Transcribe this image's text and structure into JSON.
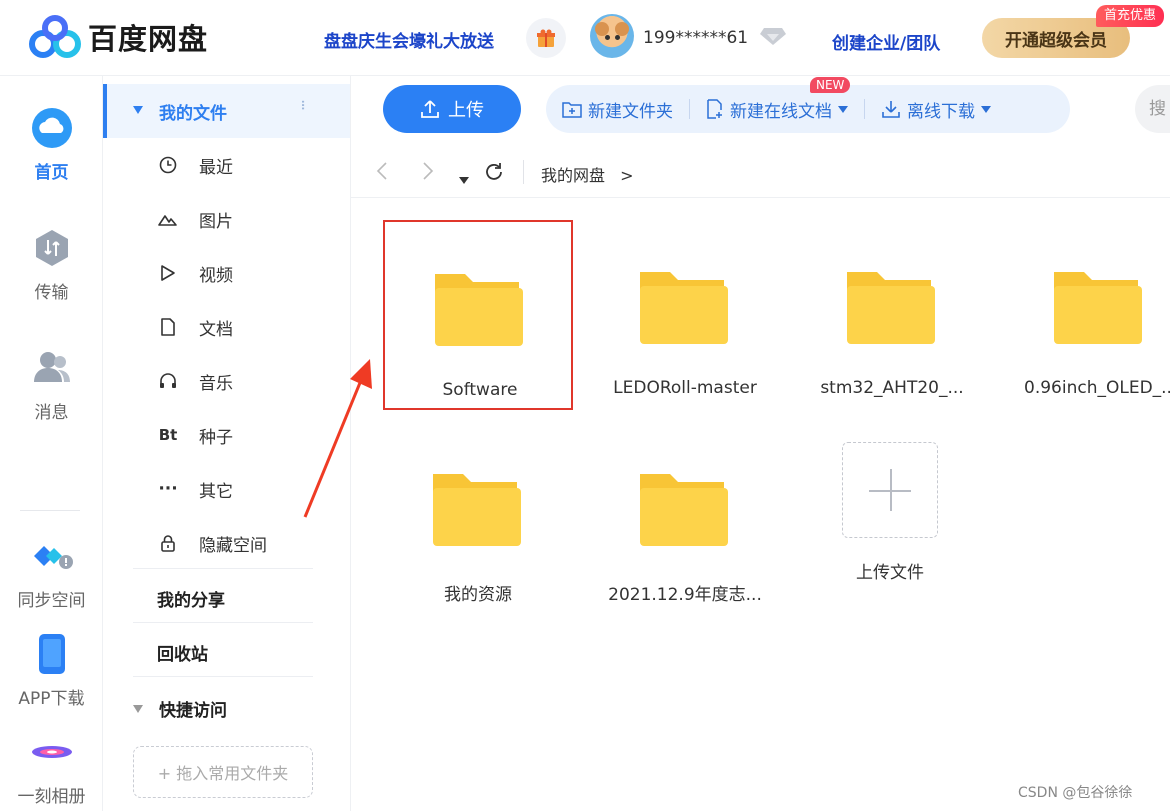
{
  "header": {
    "logo_text": "百度网盘",
    "promo_link": "盘盘庆生会壕礼大放送",
    "username": "199******61",
    "enterprise_link": "创建企业/团队",
    "vip_button": "开通超级会员",
    "vip_badge": "首充优惠"
  },
  "rail": {
    "items": [
      {
        "label": "首页",
        "icon": "cloud-icon",
        "active": true
      },
      {
        "label": "传输",
        "icon": "transfer-icon",
        "active": false
      },
      {
        "label": "消息",
        "icon": "contacts-icon",
        "active": false
      },
      {
        "label": "同步空间",
        "icon": "sync-icon",
        "active": false
      },
      {
        "label": "APP下载",
        "icon": "phone-icon",
        "active": false
      },
      {
        "label": "一刻相册",
        "icon": "album-icon",
        "active": false
      }
    ]
  },
  "nav": {
    "section_title": "我的文件",
    "items": [
      {
        "label": "最近",
        "icon": "clock-icon"
      },
      {
        "label": "图片",
        "icon": "image-icon"
      },
      {
        "label": "视频",
        "icon": "play-icon"
      },
      {
        "label": "文档",
        "icon": "document-icon"
      },
      {
        "label": "音乐",
        "icon": "headphones-icon"
      },
      {
        "label": "种子",
        "icon": "bt-icon",
        "icon_text": "Bt"
      },
      {
        "label": "其它",
        "icon": "more-icon",
        "icon_text": "···"
      },
      {
        "label": "隐藏空间",
        "icon": "lock-icon"
      }
    ],
    "share": "我的分享",
    "recycle": "回收站",
    "quick_access": "快捷访问",
    "drop_hint": "+ 拖入常用文件夹"
  },
  "toolbar": {
    "upload": "上传",
    "new_folder": "新建文件夹",
    "new_doc": "新建在线文档",
    "new_badge": "NEW",
    "offline_download": "离线下载",
    "search_placeholder": "搜"
  },
  "breadcrumb": {
    "path": "我的网盘",
    "separator": ">"
  },
  "files": [
    {
      "name": "Software",
      "type": "folder",
      "selected": true
    },
    {
      "name": "LEDORoll-master",
      "type": "folder"
    },
    {
      "name": "stm32_AHT20_...",
      "type": "folder"
    },
    {
      "name": "0.96inch_OLED_...",
      "type": "folder"
    },
    {
      "name": "我的资源",
      "type": "folder"
    },
    {
      "name": "2021.12.9年度志...",
      "type": "folder"
    }
  ],
  "upload_tile": "上传文件",
  "watermark": "CSDN @包谷徐徐",
  "colors": {
    "accent": "#2b80f4",
    "folder": "#fdd34a",
    "selection": "#e0362b"
  }
}
